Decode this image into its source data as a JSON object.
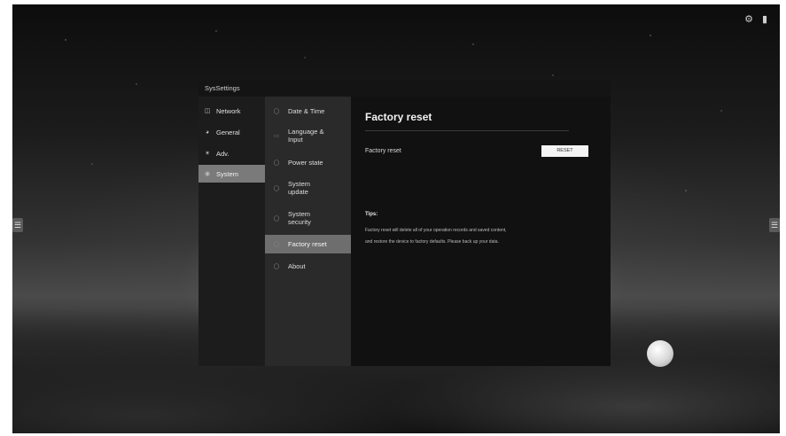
{
  "window": {
    "title": "SysSettings"
  },
  "status_icons": [
    "network-icon",
    "usb-icon"
  ],
  "nav_primary": [
    {
      "label": "Network",
      "icon": "network-icon"
    },
    {
      "label": "General",
      "icon": "general-icon"
    },
    {
      "label": "Adv.",
      "icon": "advanced-icon"
    },
    {
      "label": "System",
      "icon": "system-icon",
      "active": true
    }
  ],
  "nav_secondary": [
    {
      "label": "Date & Time",
      "icon": "clock-icon"
    },
    {
      "label": "Language & Input",
      "icon": "keyboard-icon"
    },
    {
      "label": "Power state",
      "icon": "power-icon"
    },
    {
      "label": "System update",
      "icon": "update-icon"
    },
    {
      "label": "System security",
      "icon": "shield-icon"
    },
    {
      "label": "Factory reset",
      "icon": "reset-icon",
      "active": true
    },
    {
      "label": "About",
      "icon": "info-icon"
    }
  ],
  "content": {
    "title": "Factory reset",
    "row_label": "Factory reset",
    "reset_button": "RESET",
    "tips_title": "Tips:",
    "tips_line1": "Factory reset will delete all of your operation records and saved content,",
    "tips_line2": "and restore the device to factory defaults. Please back up your data."
  },
  "colors": {
    "active_primary": "#7a7a7a",
    "active_secondary": "#6e6e6e",
    "button": "#f4f4f4"
  }
}
